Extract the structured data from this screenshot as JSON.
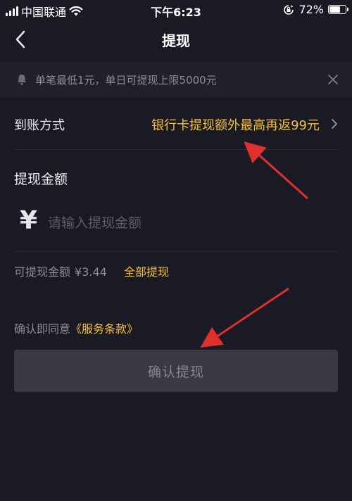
{
  "status_bar": {
    "carrier": "中国联通",
    "time": "下午6:23",
    "battery": "72%",
    "battery_level": 0.72
  },
  "nav": {
    "title": "提现"
  },
  "notice": {
    "text": "单笔最低1元，单日可提现上限5000元"
  },
  "method": {
    "label": "到账方式",
    "promo": "银行卡提现额外最高再返99元"
  },
  "amount": {
    "label": "提现金额",
    "currency_symbol": "¥",
    "placeholder": "请输入提现金额"
  },
  "available": {
    "label": "可提现金额",
    "value": "¥3.44",
    "withdraw_all": "全部提现"
  },
  "agreement": {
    "prefix": "确认即同意",
    "terms": "《服务条款》"
  },
  "confirm": {
    "label": "确认提现"
  },
  "colors": {
    "background": "#1a1a24",
    "accent": "#f3c130",
    "annotation_arrow": "#e0302c"
  }
}
